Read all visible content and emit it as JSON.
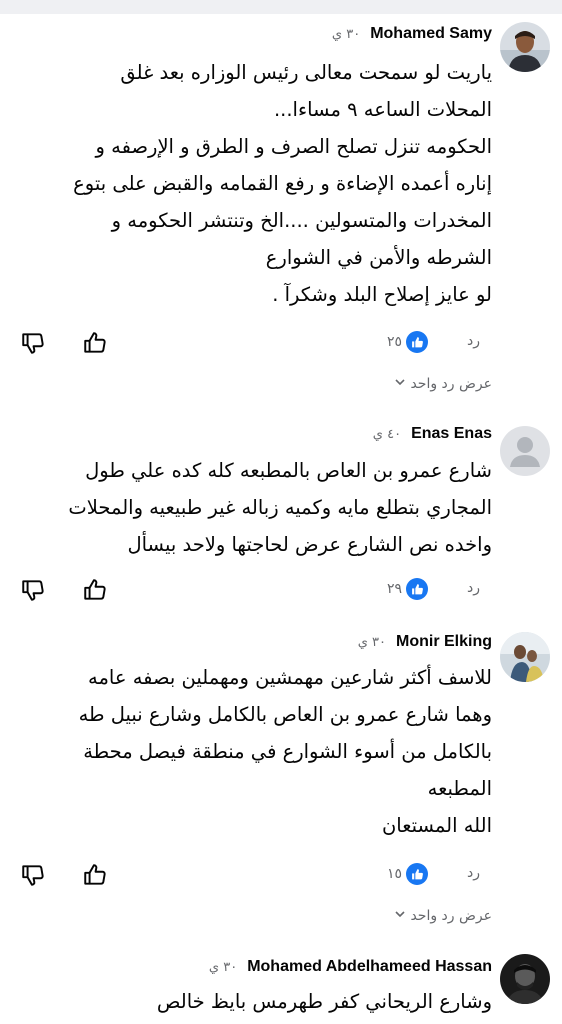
{
  "comments": [
    {
      "author": "Mohamed Samy",
      "time": "٣٠ ي",
      "lines": [
        "ياريت لو سمحت معالى رئيس الوزاره بعد غلق",
        "المحلات الساعه ٩ مساءا...",
        "الحكومه تنزل تصلح الصرف و الطرق و الإرصفه و",
        "إناره أعمده الإضاءة و رفع القمامه والقبض على بتوع",
        "المخدرات والمتسولين ....الخ وتنتشر الحكومه و",
        "الشرطه والأمن في الشوارع",
        "لو عايز إصلاح البلد وشكرآ ."
      ],
      "likes": "٢٥",
      "reply_label": "رد",
      "view_replies": "عرض رد واحد"
    },
    {
      "author": "Enas Enas",
      "time": "٤٠ ي",
      "lines": [
        "شارع عمرو بن العاص بالمطبعه كله كده علي طول",
        "المجاري بتطلع مايه وكميه زباله غير طبيعيه والمحلات",
        "واخده نص الشارع عرض لحاجتها ولاحد بيسأل"
      ],
      "likes": "٢٩",
      "reply_label": "رد"
    },
    {
      "author": "Monir Elking",
      "time": "٣٠ ي",
      "lines": [
        "للاسف أكثر شارعين مهمشين ومهملين بصفه عامه",
        "وهما شارع عمرو بن العاص بالكامل وشارع نبيل طه",
        "بالكامل من أسوء الشوارع في منطقة فيصل محطة",
        "المطبعه",
        "الله المستعان"
      ],
      "likes": "١٥",
      "reply_label": "رد",
      "view_replies": "عرض رد واحد"
    },
    {
      "author": "Mohamed Abdelhameed Hassan",
      "time": "٣٠ ي",
      "lines": [
        "وشارع الريحاني كفر طهرمس بايظ خالص"
      ]
    }
  ],
  "icons": {
    "dislike": "thumbs-down-icon",
    "like": "thumbs-up-icon",
    "reaction": "like-reaction-icon",
    "chevron": "chevron-down-icon"
  },
  "colors": {
    "like_blue": "#1877f2",
    "meta_gray": "#65676b",
    "text": "#050505"
  }
}
